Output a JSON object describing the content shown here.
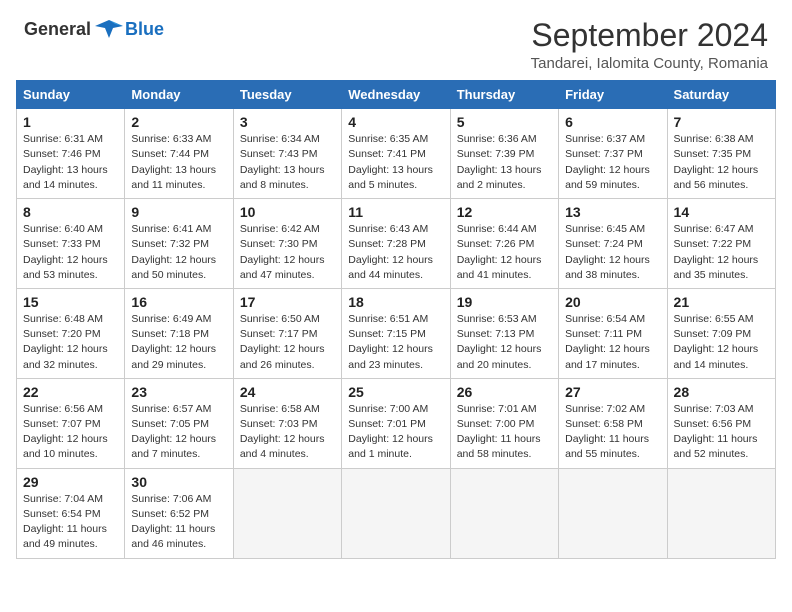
{
  "header": {
    "logo_general": "General",
    "logo_blue": "Blue",
    "month": "September 2024",
    "location": "Tandarei, Ialomita County, Romania"
  },
  "weekdays": [
    "Sunday",
    "Monday",
    "Tuesday",
    "Wednesday",
    "Thursday",
    "Friday",
    "Saturday"
  ],
  "weeks": [
    [
      {
        "day": "1",
        "sunrise": "Sunrise: 6:31 AM",
        "sunset": "Sunset: 7:46 PM",
        "daylight": "Daylight: 13 hours and 14 minutes."
      },
      {
        "day": "2",
        "sunrise": "Sunrise: 6:33 AM",
        "sunset": "Sunset: 7:44 PM",
        "daylight": "Daylight: 13 hours and 11 minutes."
      },
      {
        "day": "3",
        "sunrise": "Sunrise: 6:34 AM",
        "sunset": "Sunset: 7:43 PM",
        "daylight": "Daylight: 13 hours and 8 minutes."
      },
      {
        "day": "4",
        "sunrise": "Sunrise: 6:35 AM",
        "sunset": "Sunset: 7:41 PM",
        "daylight": "Daylight: 13 hours and 5 minutes."
      },
      {
        "day": "5",
        "sunrise": "Sunrise: 6:36 AM",
        "sunset": "Sunset: 7:39 PM",
        "daylight": "Daylight: 13 hours and 2 minutes."
      },
      {
        "day": "6",
        "sunrise": "Sunrise: 6:37 AM",
        "sunset": "Sunset: 7:37 PM",
        "daylight": "Daylight: 12 hours and 59 minutes."
      },
      {
        "day": "7",
        "sunrise": "Sunrise: 6:38 AM",
        "sunset": "Sunset: 7:35 PM",
        "daylight": "Daylight: 12 hours and 56 minutes."
      }
    ],
    [
      {
        "day": "8",
        "sunrise": "Sunrise: 6:40 AM",
        "sunset": "Sunset: 7:33 PM",
        "daylight": "Daylight: 12 hours and 53 minutes."
      },
      {
        "day": "9",
        "sunrise": "Sunrise: 6:41 AM",
        "sunset": "Sunset: 7:32 PM",
        "daylight": "Daylight: 12 hours and 50 minutes."
      },
      {
        "day": "10",
        "sunrise": "Sunrise: 6:42 AM",
        "sunset": "Sunset: 7:30 PM",
        "daylight": "Daylight: 12 hours and 47 minutes."
      },
      {
        "day": "11",
        "sunrise": "Sunrise: 6:43 AM",
        "sunset": "Sunset: 7:28 PM",
        "daylight": "Daylight: 12 hours and 44 minutes."
      },
      {
        "day": "12",
        "sunrise": "Sunrise: 6:44 AM",
        "sunset": "Sunset: 7:26 PM",
        "daylight": "Daylight: 12 hours and 41 minutes."
      },
      {
        "day": "13",
        "sunrise": "Sunrise: 6:45 AM",
        "sunset": "Sunset: 7:24 PM",
        "daylight": "Daylight: 12 hours and 38 minutes."
      },
      {
        "day": "14",
        "sunrise": "Sunrise: 6:47 AM",
        "sunset": "Sunset: 7:22 PM",
        "daylight": "Daylight: 12 hours and 35 minutes."
      }
    ],
    [
      {
        "day": "15",
        "sunrise": "Sunrise: 6:48 AM",
        "sunset": "Sunset: 7:20 PM",
        "daylight": "Daylight: 12 hours and 32 minutes."
      },
      {
        "day": "16",
        "sunrise": "Sunrise: 6:49 AM",
        "sunset": "Sunset: 7:18 PM",
        "daylight": "Daylight: 12 hours and 29 minutes."
      },
      {
        "day": "17",
        "sunrise": "Sunrise: 6:50 AM",
        "sunset": "Sunset: 7:17 PM",
        "daylight": "Daylight: 12 hours and 26 minutes."
      },
      {
        "day": "18",
        "sunrise": "Sunrise: 6:51 AM",
        "sunset": "Sunset: 7:15 PM",
        "daylight": "Daylight: 12 hours and 23 minutes."
      },
      {
        "day": "19",
        "sunrise": "Sunrise: 6:53 AM",
        "sunset": "Sunset: 7:13 PM",
        "daylight": "Daylight: 12 hours and 20 minutes."
      },
      {
        "day": "20",
        "sunrise": "Sunrise: 6:54 AM",
        "sunset": "Sunset: 7:11 PM",
        "daylight": "Daylight: 12 hours and 17 minutes."
      },
      {
        "day": "21",
        "sunrise": "Sunrise: 6:55 AM",
        "sunset": "Sunset: 7:09 PM",
        "daylight": "Daylight: 12 hours and 14 minutes."
      }
    ],
    [
      {
        "day": "22",
        "sunrise": "Sunrise: 6:56 AM",
        "sunset": "Sunset: 7:07 PM",
        "daylight": "Daylight: 12 hours and 10 minutes."
      },
      {
        "day": "23",
        "sunrise": "Sunrise: 6:57 AM",
        "sunset": "Sunset: 7:05 PM",
        "daylight": "Daylight: 12 hours and 7 minutes."
      },
      {
        "day": "24",
        "sunrise": "Sunrise: 6:58 AM",
        "sunset": "Sunset: 7:03 PM",
        "daylight": "Daylight: 12 hours and 4 minutes."
      },
      {
        "day": "25",
        "sunrise": "Sunrise: 7:00 AM",
        "sunset": "Sunset: 7:01 PM",
        "daylight": "Daylight: 12 hours and 1 minute."
      },
      {
        "day": "26",
        "sunrise": "Sunrise: 7:01 AM",
        "sunset": "Sunset: 7:00 PM",
        "daylight": "Daylight: 11 hours and 58 minutes."
      },
      {
        "day": "27",
        "sunrise": "Sunrise: 7:02 AM",
        "sunset": "Sunset: 6:58 PM",
        "daylight": "Daylight: 11 hours and 55 minutes."
      },
      {
        "day": "28",
        "sunrise": "Sunrise: 7:03 AM",
        "sunset": "Sunset: 6:56 PM",
        "daylight": "Daylight: 11 hours and 52 minutes."
      }
    ],
    [
      {
        "day": "29",
        "sunrise": "Sunrise: 7:04 AM",
        "sunset": "Sunset: 6:54 PM",
        "daylight": "Daylight: 11 hours and 49 minutes."
      },
      {
        "day": "30",
        "sunrise": "Sunrise: 7:06 AM",
        "sunset": "Sunset: 6:52 PM",
        "daylight": "Daylight: 11 hours and 46 minutes."
      },
      null,
      null,
      null,
      null,
      null
    ]
  ]
}
